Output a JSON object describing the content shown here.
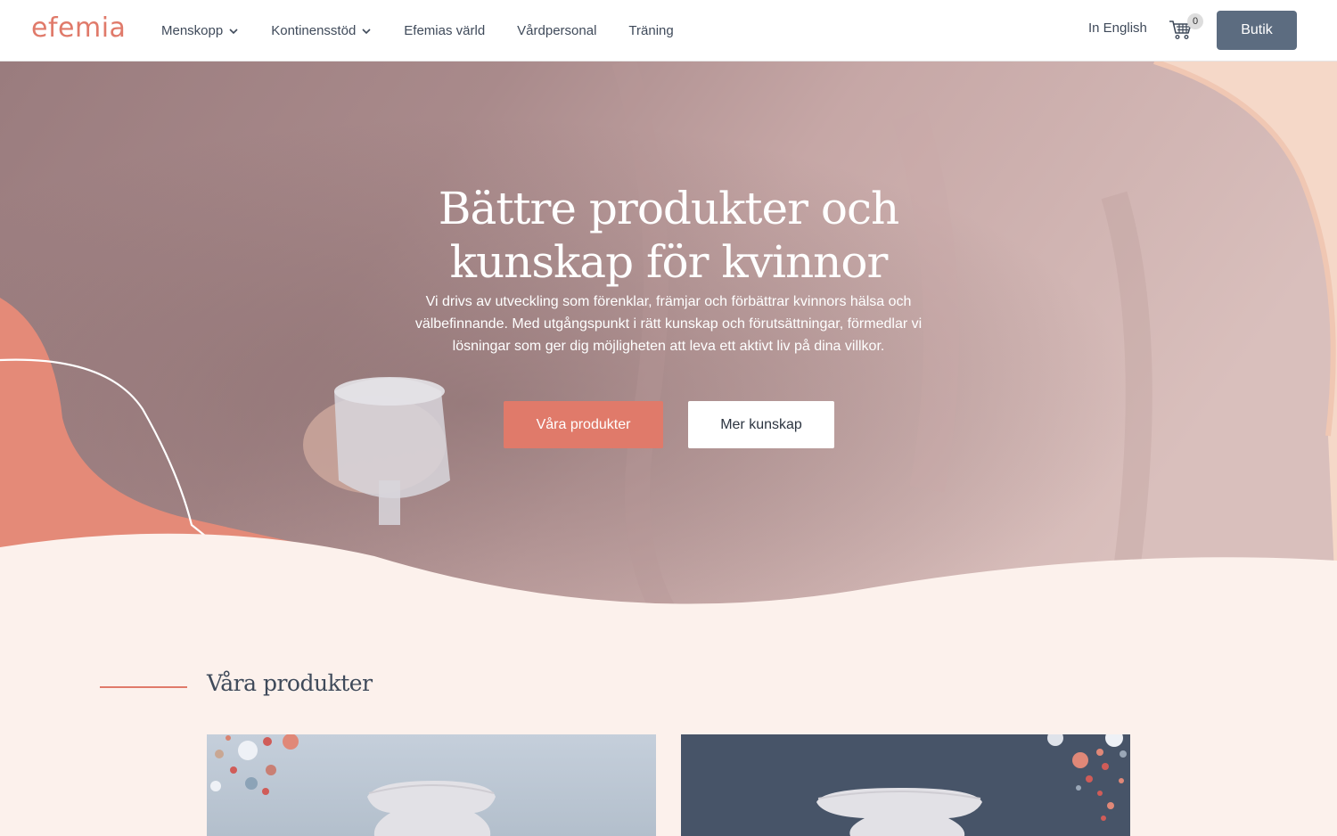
{
  "brand": {
    "logo": "efemia",
    "accent": "#e07a6a",
    "dark": "#5c6c80"
  },
  "nav": {
    "items": [
      {
        "label": "Menskopp",
        "dropdown": true
      },
      {
        "label": "Kontinensstöd",
        "dropdown": true
      },
      {
        "label": "Efemias värld",
        "dropdown": false
      },
      {
        "label": "Vårdpersonal",
        "dropdown": false
      },
      {
        "label": "Träning",
        "dropdown": false
      }
    ],
    "language": "In English",
    "cart_count": "0",
    "shop_label": "Butik"
  },
  "hero": {
    "title_line1": "Bättre produkter och",
    "title_line2": "kunskap för kvinnor",
    "text": "Vi drivs av utveckling som förenklar, främjar och förbättrar kvinnors hälsa och välbefinnande. Med utgångspunkt i rätt kunskap och förutsättningar, förmedlar vi lösningar som ger dig möjligheten att leva ett aktivt liv på dina villkor.",
    "primary_button": "Våra produkter",
    "secondary_button": "Mer kunskap"
  },
  "products": {
    "section_title": "Våra produkter"
  }
}
